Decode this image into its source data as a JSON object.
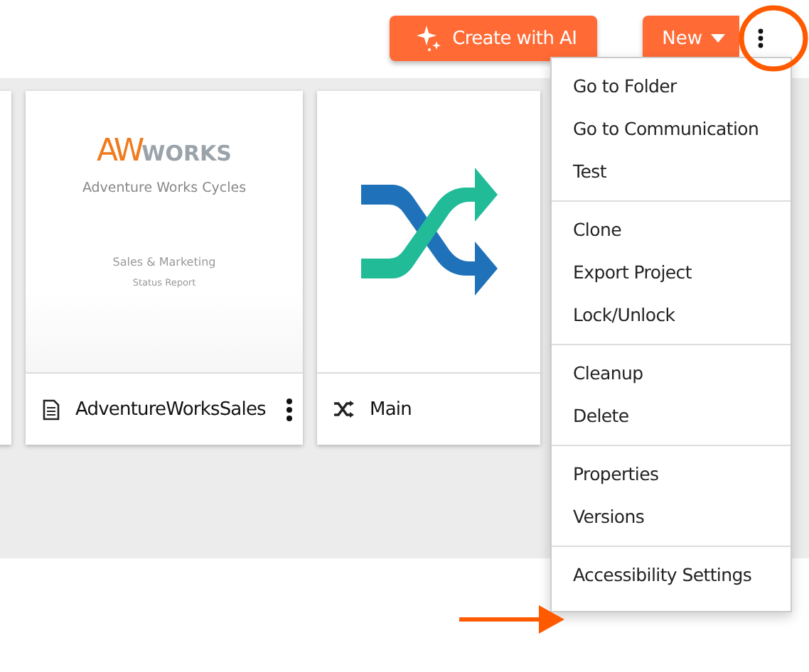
{
  "toolbar": {
    "buttons": [
      {
        "kind": "ai",
        "label": "Create with AI"
      },
      {
        "kind": "dropdown",
        "label": "New"
      },
      {
        "kind": "more"
      }
    ]
  },
  "cards": [
    {
      "kind": "partial"
    },
    {
      "kind": "report",
      "title": "AdventureWorksSales",
      "preview": {
        "logo_mark": "AW",
        "logo_word": "WORKS",
        "company": "Adventure Works Cycles",
        "subject": "Sales & Marketing",
        "subtitle": "Status Report"
      },
      "has_menu": true
    },
    {
      "kind": "flow",
      "title": "Main",
      "has_menu": false
    }
  ],
  "menu": {
    "groups": [
      [
        "Go to Folder",
        "Go to Communication",
        "Test"
      ],
      [
        "Clone",
        "Export Project",
        "Lock/Unlock"
      ],
      [
        "Cleanup",
        "Delete"
      ],
      [
        "Properties",
        "Versions"
      ],
      [
        "Accessibility Settings"
      ]
    ]
  },
  "callouts": {
    "highlight_more_button": true,
    "arrow_to_menu_item": true
  }
}
